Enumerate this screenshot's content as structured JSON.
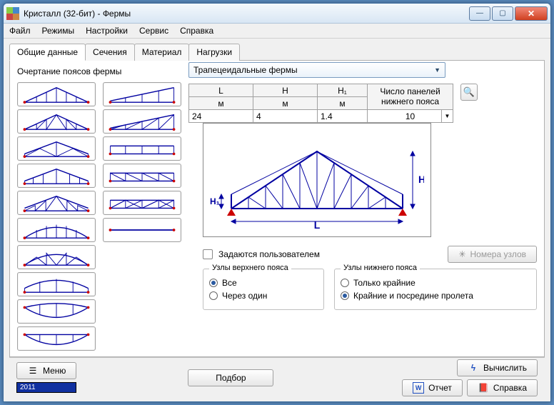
{
  "window": {
    "title": "Кристалл (32-бит) - Фермы"
  },
  "menu": {
    "file": "Файл",
    "modes": "Режимы",
    "settings": "Настройки",
    "service": "Сервис",
    "help": "Справка"
  },
  "tabs": {
    "t0": "Общие данные",
    "t1": "Сечения",
    "t2": "Материал",
    "t3": "Нагрузки"
  },
  "left": {
    "label": "Очертание поясов фермы"
  },
  "combo": {
    "value": "Трапецеидальные фермы"
  },
  "params": {
    "h_L": "L",
    "h_H": "H",
    "h_H1": "H₁",
    "h_panels_l1": "Число панелей",
    "h_panels_l2": "нижнего пояса",
    "u": "м",
    "v_L": "24",
    "v_H": "4",
    "v_H1": "1.4",
    "v_panels": "10"
  },
  "opts": {
    "user_defined": "Задаются пользователем",
    "node_numbers": "Номера узлов",
    "upper_legend": "Узлы верхнего пояса",
    "upper_all": "Все",
    "upper_alt": "Через один",
    "lower_legend": "Узлы нижнего пояса",
    "lower_ends": "Только крайние",
    "lower_mid": "Крайние и посредине пролета"
  },
  "diagram": {
    "L": "L",
    "H": "H",
    "H1": "H₁"
  },
  "bottom": {
    "menu": "Меню",
    "year": "2011",
    "podbor": "Подбор",
    "calc": "Вычислить",
    "report": "Отчет",
    "help": "Справка"
  }
}
